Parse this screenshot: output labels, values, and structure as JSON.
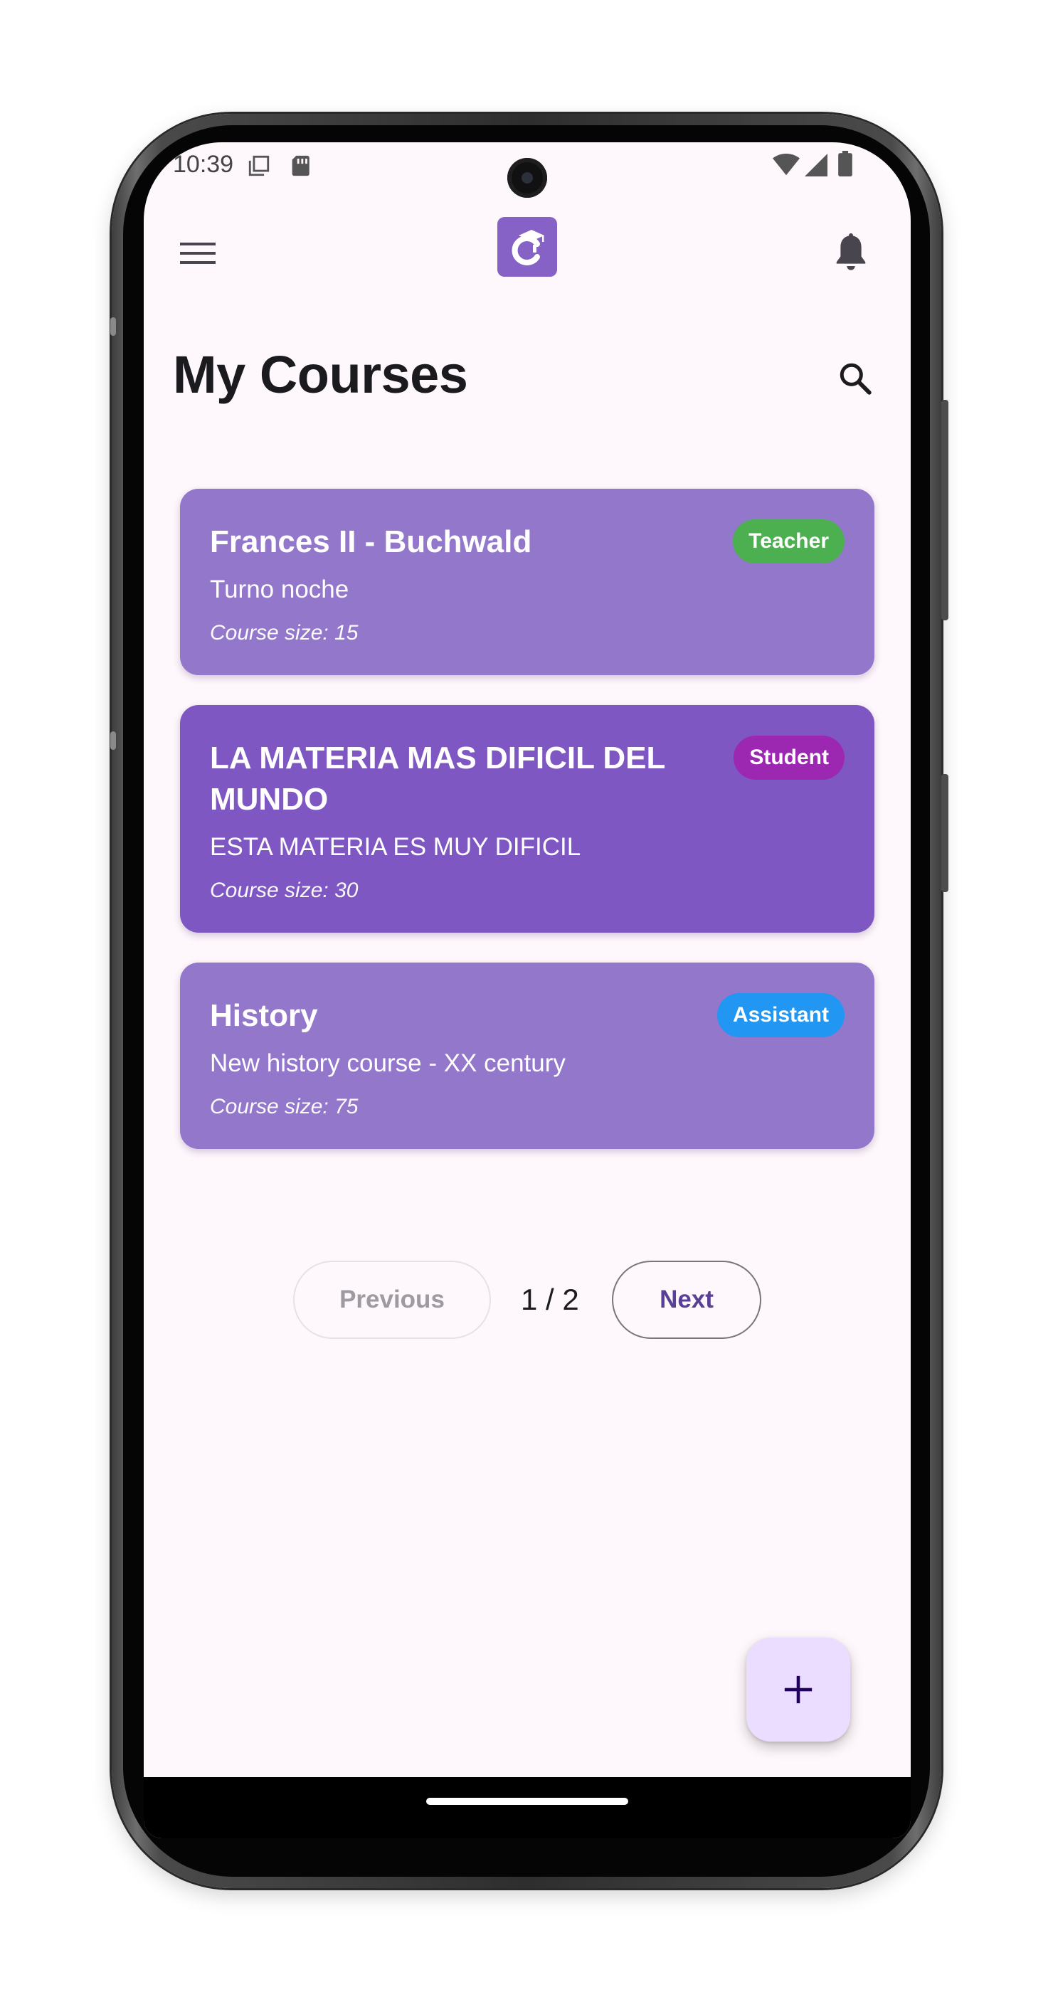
{
  "status_bar": {
    "time": "10:39"
  },
  "header": {
    "title": "My Courses"
  },
  "courses": [
    {
      "title": "Frances II - Buchwald",
      "description": "Turno noche",
      "size_text": "Course size: 15",
      "role": "Teacher",
      "role_color": "#4caf50",
      "card_color": "#9377cb"
    },
    {
      "title": "LA MATERIA MAS DIFICIL DEL MUNDO",
      "description": "ESTA MATERIA ES MUY DIFICIL",
      "size_text": "Course size: 30",
      "role": "Student",
      "role_color": "#9c27b0",
      "card_color": "#7e57c2"
    },
    {
      "title": "History",
      "description": "New history course - XX century",
      "size_text": "Course size: 75",
      "role": "Assistant",
      "role_color": "#2196f3",
      "card_color": "#9377cb"
    }
  ],
  "pagination": {
    "previous_label": "Previous",
    "page_label": "1 / 2",
    "next_label": "Next",
    "current_page": 1,
    "total_pages": 2
  },
  "fab": {
    "icon": "plus-icon"
  },
  "icons": {
    "menu": "menu-icon",
    "logo": "app-logo-icon",
    "notifications": "bell-icon",
    "search": "search-icon"
  },
  "colors": {
    "accent": "#7e57c2",
    "background": "#fef7fb",
    "fab_background": "#eaddff"
  }
}
